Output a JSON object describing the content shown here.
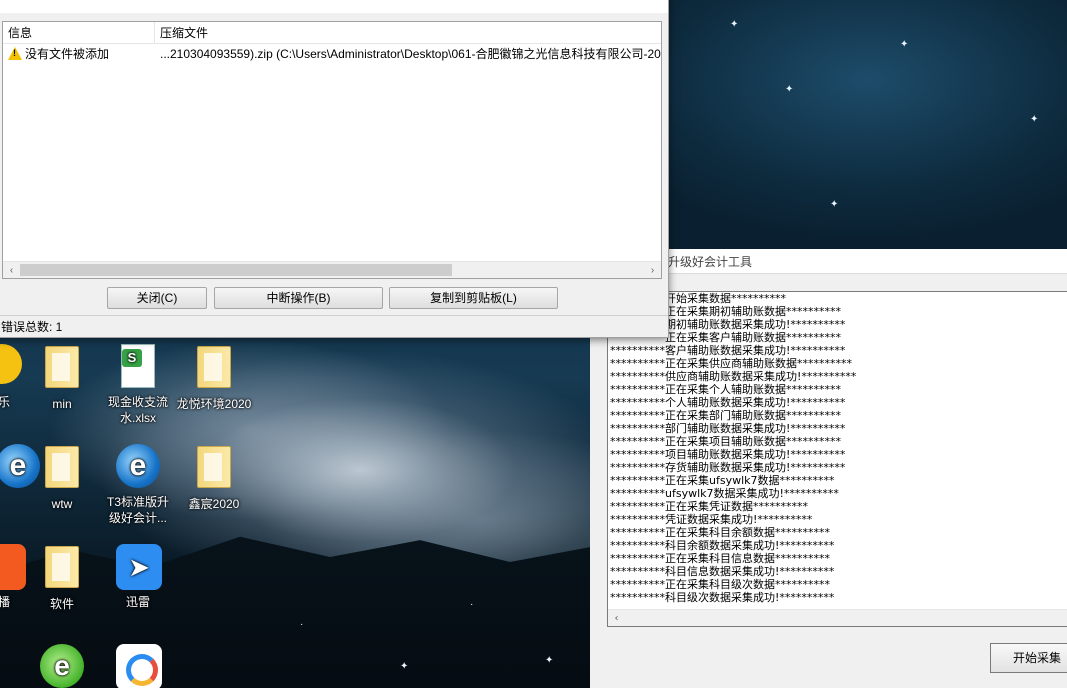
{
  "dialog": {
    "columns": [
      "信息",
      "压缩文件"
    ],
    "rows": [
      {
        "icon": "warning-icon",
        "info": "没有文件被添加",
        "archive": "...210304093559).zip (C:\\Users\\Administrator\\Desktop\\061-合肥徽锦之光信息科技有限公司-2020(2"
      }
    ],
    "buttons": {
      "close": "关闭(C)",
      "abort": "中断操作(B)",
      "copy": "复制到剪贴板(L)"
    },
    "status": "错误总数: 1",
    "scroll_left": "‹",
    "scroll_right": "›"
  },
  "desktop": {
    "icons": [
      {
        "label": "乐"
      },
      {
        "label": "min"
      },
      {
        "label": "现金收支流水.xlsx"
      },
      {
        "label": "龙悦环境2020"
      },
      {
        "label": "wtw"
      },
      {
        "label": "T3标准版升级好会计..."
      },
      {
        "label": "鑫宸2020"
      },
      {
        "label": "播"
      },
      {
        "label": "软件"
      },
      {
        "label": "迅雷"
      }
    ]
  },
  "app": {
    "title": "升级好会计工具",
    "log_lines": [
      "**********开始采集数据**********",
      "**********正在采集期初辅助账数据**********",
      "**********期初辅助账数据采集成功!**********",
      "**********正在采集客户辅助账数据**********",
      "**********客户辅助账数据采集成功!**********",
      "**********正在采集供应商辅助账数据**********",
      "**********供应商辅助账数据采集成功!**********",
      "**********正在采集个人辅助账数据**********",
      "**********个人辅助账数据采集成功!**********",
      "**********正在采集部门辅助账数据**********",
      "**********部门辅助账数据采集成功!**********",
      "**********正在采集项目辅助账数据**********",
      "**********项目辅助账数据采集成功!**********",
      "**********存货辅助账数据采集成功!**********",
      "**********正在采集ufsywlk7数据**********",
      "**********ufsywlk7数据采集成功!**********",
      "**********正在采集凭证数据**********",
      "**********凭证数据采集成功!**********",
      "**********正在采集科目余额数据**********",
      "**********科目余额数据采集成功!**********",
      "**********正在采集科目信息数据**********",
      "**********科目信息数据采集成功!**********",
      "**********正在采集科目级次数据**********",
      "**********科目级次数据采集成功!**********"
    ],
    "start_button": "开始采集",
    "scroll_left": "‹"
  }
}
